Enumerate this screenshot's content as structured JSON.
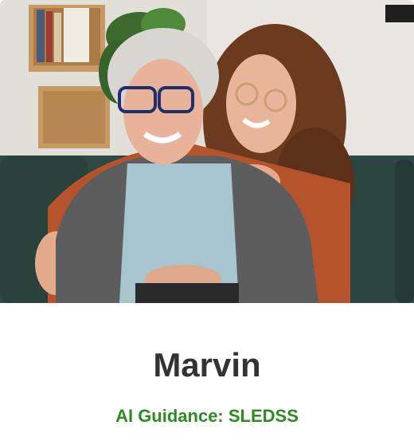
{
  "card": {
    "image_alt": "Smiling older woman with glasses and a young curly-haired woman hugging her from behind on a sofa",
    "name": "Marvin",
    "subtitle": "AI Guidance: SLEDSS"
  },
  "colors": {
    "name_text": "#333333",
    "subtitle_text": "#2e8b22",
    "background": "#ffffff"
  }
}
